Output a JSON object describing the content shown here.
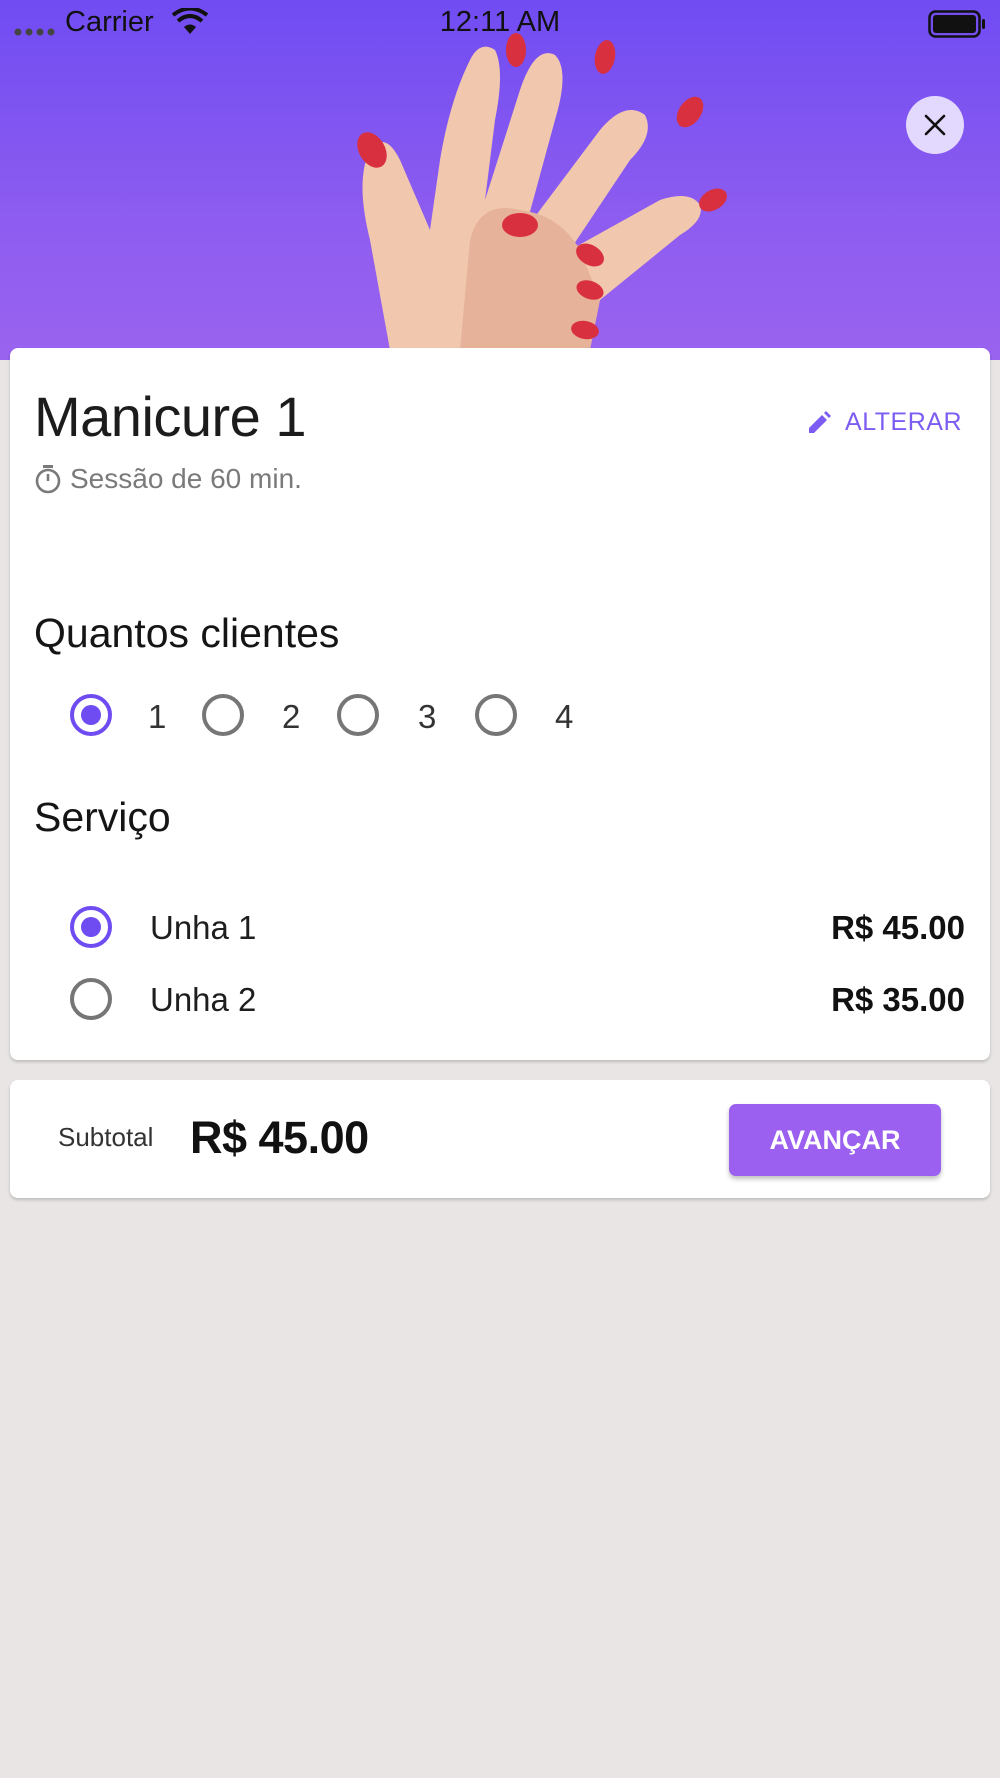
{
  "status_bar": {
    "carrier": "Carrier",
    "time": "12:11 AM"
  },
  "header": {
    "close_icon": "close-icon"
  },
  "service": {
    "title": "Manicure 1",
    "session": "Sessão de 60 min.",
    "alter_label": "ALTERAR"
  },
  "clients": {
    "heading": "Quantos clientes",
    "options": [
      "1",
      "2",
      "3",
      "4"
    ],
    "selected": "1"
  },
  "services": {
    "heading": "Serviço",
    "items": [
      {
        "name": "Unha 1",
        "price": "R$ 45.00",
        "selected": true
      },
      {
        "name": "Unha 2",
        "price": "R$ 35.00",
        "selected": false
      }
    ]
  },
  "footer": {
    "subtotal_label": "Subtotal",
    "subtotal_value": "R$ 45.00",
    "advance_label": "AVANÇAR"
  },
  "colors": {
    "accent": "#6f4cf2",
    "button": "#9b60ef",
    "header_top": "#704cf2",
    "background": "#e8e5e4"
  }
}
